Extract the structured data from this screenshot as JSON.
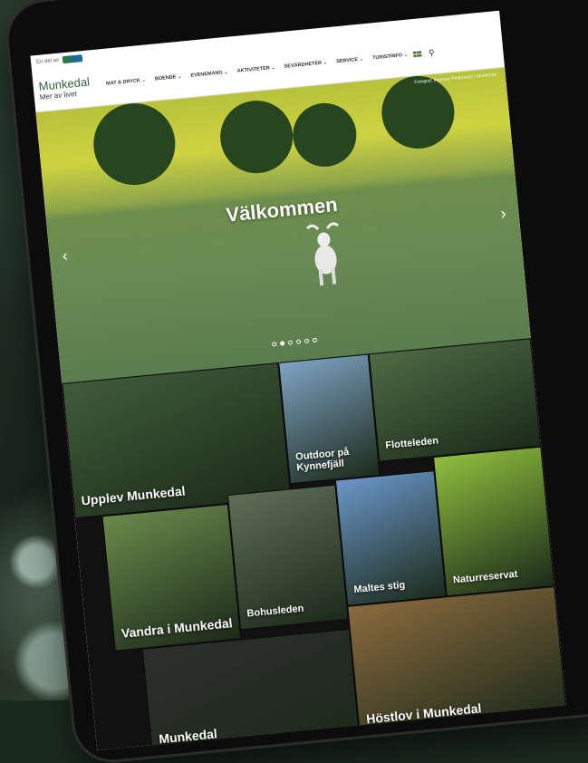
{
  "topbar": {
    "prefix": "En del av",
    "partner": "VÄSTRA GÖTALANDSREGIONEN"
  },
  "logo": {
    "title": "Munkedal",
    "subtitle": "Mer av livet"
  },
  "nav": [
    "MAT & DRYCK ⌄",
    "BOENDE ⌄",
    "EVENEMANG ⌄",
    "AKTIVITETER ⌄",
    "SEVÄRDHETER ⌄",
    "SERVICE ⌄",
    "TURISTINFO ⌄"
  ],
  "hero": {
    "credit": "Fotograf: Ingemar Pettersson | Munkedal",
    "title": "Välkommen",
    "prev": "‹",
    "next": "›",
    "slides": 6,
    "active_slide": 2
  },
  "tiles": [
    {
      "label": "Upplev Munkedal",
      "color": "#3f5c3a"
    },
    {
      "label": "Outdoor på Kynnefjäll",
      "color": "#7fa3c4"
    },
    {
      "label": "Flotteleden",
      "color": "#4e6b44"
    },
    {
      "label": "Vandra i Munkedal",
      "color": "#6b8a4c"
    },
    {
      "label": "Bohusleden",
      "color": "#5e6e58"
    },
    {
      "label": "Maltes stig",
      "color": "#6a96c8"
    },
    {
      "label": "Naturreservat",
      "color": "#8fbf3e"
    },
    {
      "label": "Höstlov i Munkedal",
      "color": "#8a6a3e"
    },
    {
      "label": "Munkedal",
      "color": "#2e2e2e"
    }
  ]
}
